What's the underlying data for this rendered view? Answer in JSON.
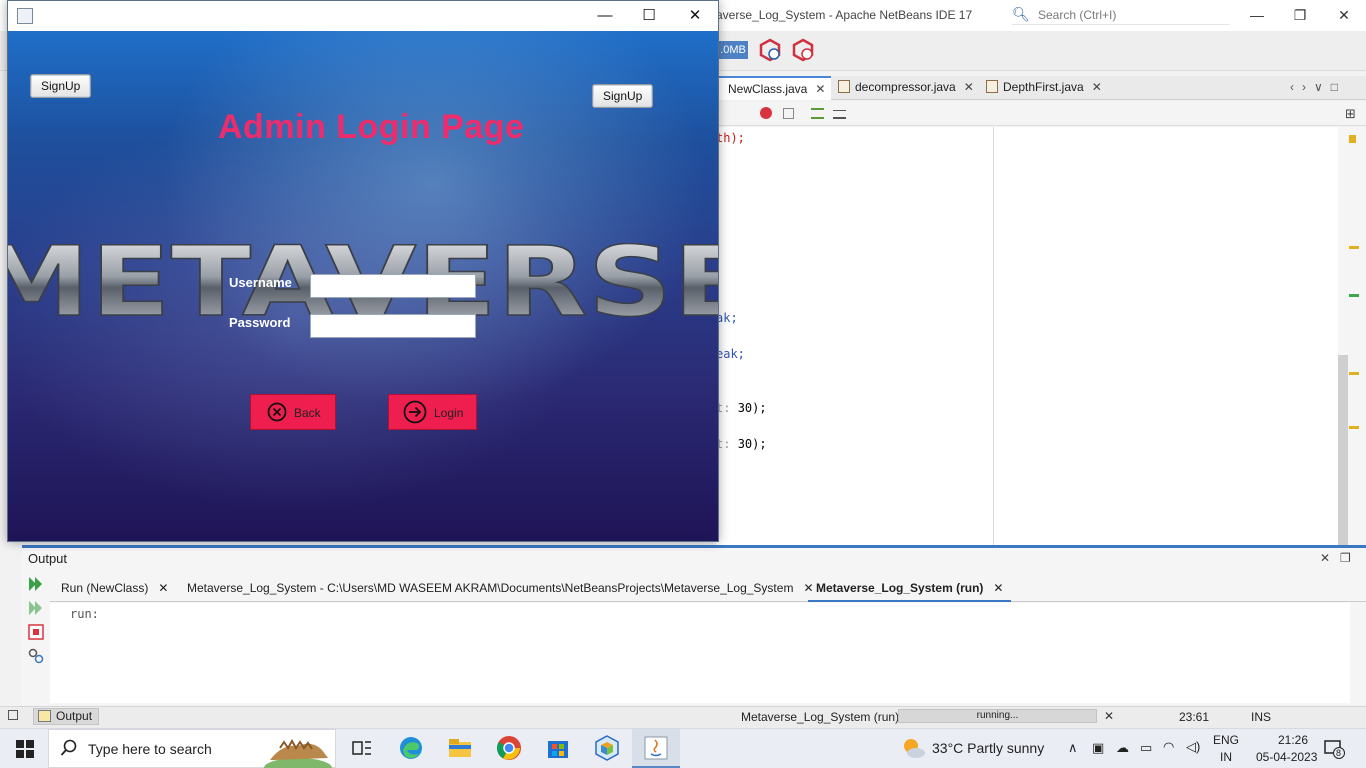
{
  "ide": {
    "title": "averse_Log_System - Apache NetBeans IDE 17",
    "search_placeholder": "Search (Ctrl+I)",
    "memory_label": ".0MB",
    "editor_tabs": [
      {
        "label": "NewClass.java",
        "active": true
      },
      {
        "label": "decompressor.java",
        "active": false
      },
      {
        "label": "DepthFirst.java",
        "active": false
      }
    ],
    "code_fragments": [
      {
        "text": "th);"
      },
      {
        "text": "ak;"
      },
      {
        "text": "eak;"
      },
      {
        "hint": "t: ",
        "value": "30);"
      },
      {
        "hint": "t: ",
        "value": "30);"
      }
    ]
  },
  "output": {
    "title": "Output",
    "tabs": [
      {
        "label": "Run (NewClass)",
        "active": false
      },
      {
        "label": "Metaverse_Log_System - C:\\Users\\MD WASEEM AKRAM\\Documents\\NetBeansProjects\\Metaverse_Log_System",
        "active": false
      },
      {
        "label": "Metaverse_Log_System (run)",
        "active": true
      }
    ],
    "content": "run:"
  },
  "status": {
    "output_button": "Output",
    "task": "Metaverse_Log_System (run)",
    "progress_text": "running...",
    "position": "23:61",
    "mode": "INS"
  },
  "app": {
    "title": "Admin Login Page",
    "signup_left": "SignUp",
    "signup_right": "SignUp",
    "banner_text": "METAVERSE",
    "username_label": "Username",
    "password_label": "Password",
    "username_value": "",
    "password_value": "",
    "back_label": "Back",
    "login_label": "Login"
  },
  "taskbar": {
    "search_placeholder": "Type here to search",
    "weather": "33°C  Partly sunny",
    "lang_line1": "ENG",
    "lang_line2": "IN",
    "time": "21:26",
    "date": "05-04-2023",
    "notification_count": "8"
  },
  "colors": {
    "title_pink": "#ee2c6c",
    "button_red": "#ee1f4f",
    "accent_blue": "#3a78c4"
  }
}
